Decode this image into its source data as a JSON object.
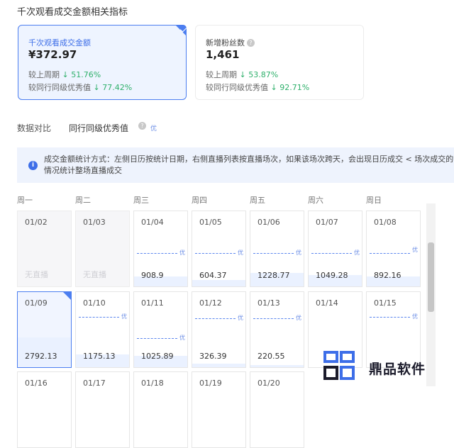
{
  "page_title": "千次观看成交金额相关指标",
  "metrics": [
    {
      "label": "千次观看成交金额",
      "value": "¥372.97",
      "prev_label": "较上周期",
      "prev_value": "↓ 51.76%",
      "peer_label": "较同行同级优秀值",
      "peer_value": "↓ 77.42%",
      "selected": true
    },
    {
      "label": "新增粉丝数",
      "value": "1,461",
      "prev_label": "较上周期",
      "prev_value": "↓ 53.87%",
      "peer_label": "较同行同级优秀值",
      "peer_value": "↓ 92.71%",
      "selected": false
    }
  ],
  "compare": {
    "label": "数据对比",
    "option": "同行同级优秀值",
    "tag": "优"
  },
  "notice": {
    "icon": "info-icon",
    "text": "成交金额统计方式：左侧日历按统计日期，右侧直播列表按直播场次，如果该场次跨天，会出现日历成交 < 场次成交的情况统计整场直播成交"
  },
  "weekdays": [
    "周一",
    "周二",
    "周三",
    "周四",
    "周五",
    "周六",
    "周日"
  ],
  "calendar": {
    "no_live_label": "无直播",
    "benchmark_tag": "优",
    "weeks": [
      [
        {
          "date": "01/02",
          "value": null,
          "fill": 0,
          "benchmark": null
        },
        {
          "date": "01/03",
          "value": null,
          "fill": 0,
          "benchmark": null
        },
        {
          "date": "01/04",
          "value": "908.9",
          "fill": 0.33,
          "benchmark": 0.57
        },
        {
          "date": "01/05",
          "value": "604.37",
          "fill": 0.22,
          "benchmark": 0.57
        },
        {
          "date": "01/06",
          "value": "1228.77",
          "fill": 0.45,
          "benchmark": 0.57
        },
        {
          "date": "01/07",
          "value": "1049.28",
          "fill": 0.38,
          "benchmark": 0.57
        },
        {
          "date": "01/08",
          "value": "892.16",
          "fill": 0.33,
          "benchmark": 0.57,
          "tag_top": true
        }
      ],
      [
        {
          "date": "01/09",
          "value": "2792.13",
          "fill": 1.0,
          "benchmark": null,
          "selected": true
        },
        {
          "date": "01/10",
          "value": "1175.13",
          "fill": 0.42,
          "benchmark": 0.85
        },
        {
          "date": "01/11",
          "value": "1025.89",
          "fill": 0.37,
          "benchmark": 0.5
        },
        {
          "date": "01/12",
          "value": "326.39",
          "fill": 0.12,
          "benchmark": 0.82
        },
        {
          "date": "01/13",
          "value": "220.55",
          "fill": 0.08,
          "benchmark": 0.82
        },
        {
          "date": "01/14",
          "value": null,
          "fill": 0,
          "benchmark": null
        },
        {
          "date": "01/15",
          "value": null,
          "fill": 0,
          "benchmark": 0.85
        }
      ],
      [
        {
          "date": "01/16"
        },
        {
          "date": "01/17"
        },
        {
          "date": "01/18"
        },
        {
          "date": "01/19"
        },
        {
          "date": "01/20"
        }
      ]
    ]
  },
  "watermark": {
    "text": "鼎品软件"
  }
}
